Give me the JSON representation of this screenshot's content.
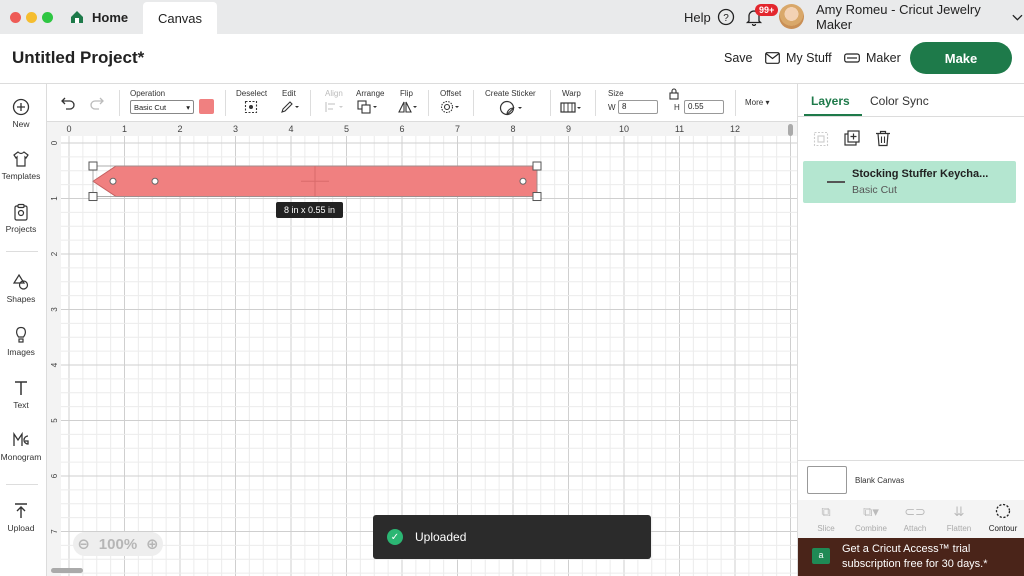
{
  "window": {
    "tabs": {
      "home": "Home",
      "canvas": "Canvas"
    },
    "help": "Help",
    "notifications": "99+",
    "user": "Amy Romeu - Cricut Jewelry Maker"
  },
  "project": {
    "title": "Untitled Project*",
    "save": "Save",
    "my_stuff": "My Stuff",
    "machine": "Maker",
    "make": "Make"
  },
  "left_tools": [
    "New",
    "Templates",
    "Projects",
    "Shapes",
    "Images",
    "Text",
    "Monogram",
    "Upload"
  ],
  "edit_toolbar": {
    "operation_label": "Operation",
    "operation_value": "Basic Cut",
    "deselect": "Deselect",
    "edit": "Edit",
    "align": "Align",
    "arrange": "Arrange",
    "flip": "Flip",
    "offset": "Offset",
    "create_sticker": "Create Sticker",
    "warp": "Warp",
    "size": "Size",
    "w_label": "W",
    "w_value": "8",
    "h_label": "H",
    "h_value": "0.55",
    "more": "More",
    "shape_color": "#f08080"
  },
  "canvas": {
    "ruler_x": [
      "0",
      "1",
      "2",
      "3",
      "4",
      "5",
      "6",
      "7",
      "8",
      "9",
      "10",
      "11",
      "12"
    ],
    "ruler_y": [
      "0",
      "1",
      "2",
      "3",
      "4",
      "5",
      "6",
      "7"
    ],
    "size_tooltip": "8  in x 0.55  in",
    "zoom": "100%",
    "toast": "Uploaded"
  },
  "right_panel": {
    "tabs": [
      "Layers",
      "Color Sync"
    ],
    "layer": {
      "name": "Stocking Stuffer Keycha...",
      "type": "Basic Cut"
    },
    "blank_canvas": "Blank Canvas",
    "bottom_tools": [
      "Slice",
      "Combine",
      "Attach",
      "Flatten",
      "Contour"
    ],
    "promo": "Get a Cricut Access™ trial subscription free for 30 days.*"
  },
  "colors": {
    "brand_green": "#1e7a4a",
    "layer_highlight": "#b4e6d0",
    "shape": "#f08080"
  }
}
